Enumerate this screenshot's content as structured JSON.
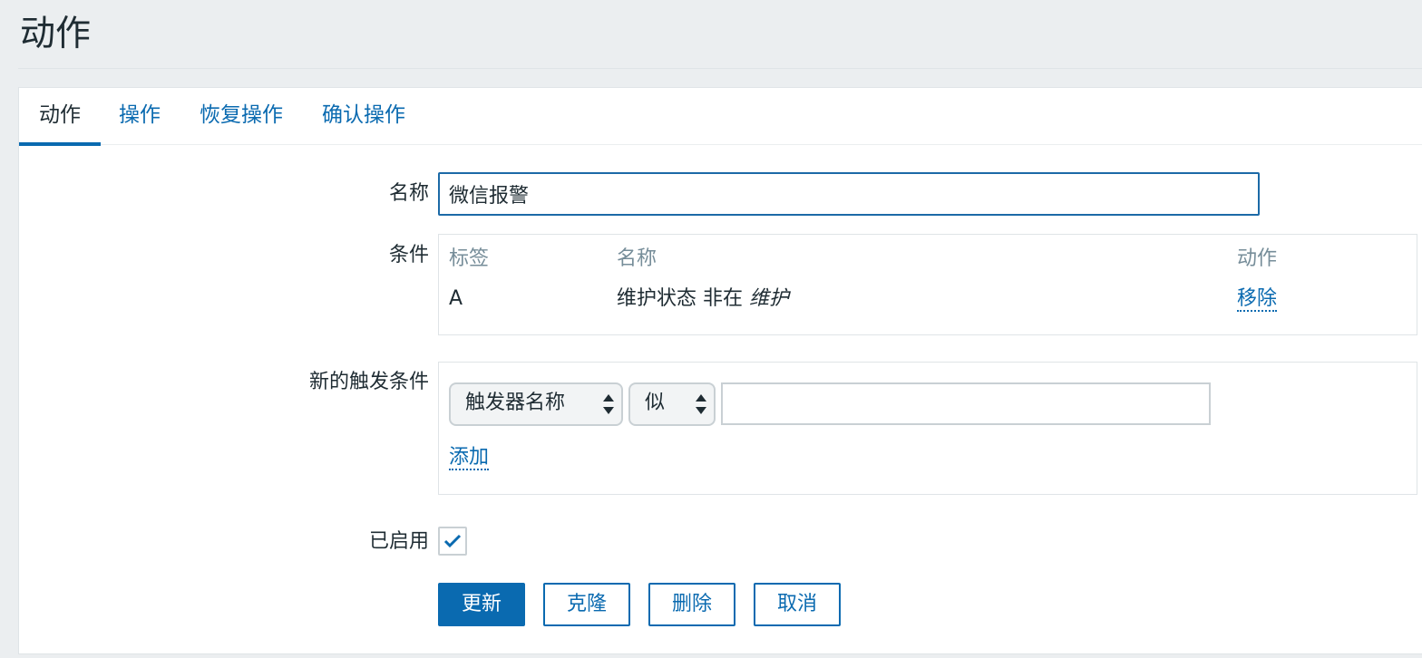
{
  "page": {
    "title": "动作"
  },
  "tabs": [
    {
      "label": "动作",
      "active": true
    },
    {
      "label": "操作",
      "active": false
    },
    {
      "label": "恢复操作",
      "active": false
    },
    {
      "label": "确认操作",
      "active": false
    }
  ],
  "form": {
    "name_label": "名称",
    "name_value": "微信报警",
    "conditions_label": "条件",
    "conditions": {
      "headers": {
        "tag": "标签",
        "name": "名称",
        "action": "动作"
      },
      "rows": [
        {
          "tag": "A",
          "name_prefix": "维护状态 非在",
          "name_italic": "维护",
          "action": "移除"
        }
      ]
    },
    "new_condition_label": "新的触发条件",
    "new_condition": {
      "type_select": "触发器名称",
      "operator_select": "似",
      "value": "",
      "add_link": "添加"
    },
    "enabled_label": "已启用",
    "enabled": true
  },
  "buttons": {
    "update": "更新",
    "clone": "克隆",
    "delete": "删除",
    "cancel": "取消"
  },
  "colors": {
    "accent": "#0a6ab0",
    "background": "#ebeef0",
    "text": "#1f2c33",
    "muted": "#768d99"
  }
}
